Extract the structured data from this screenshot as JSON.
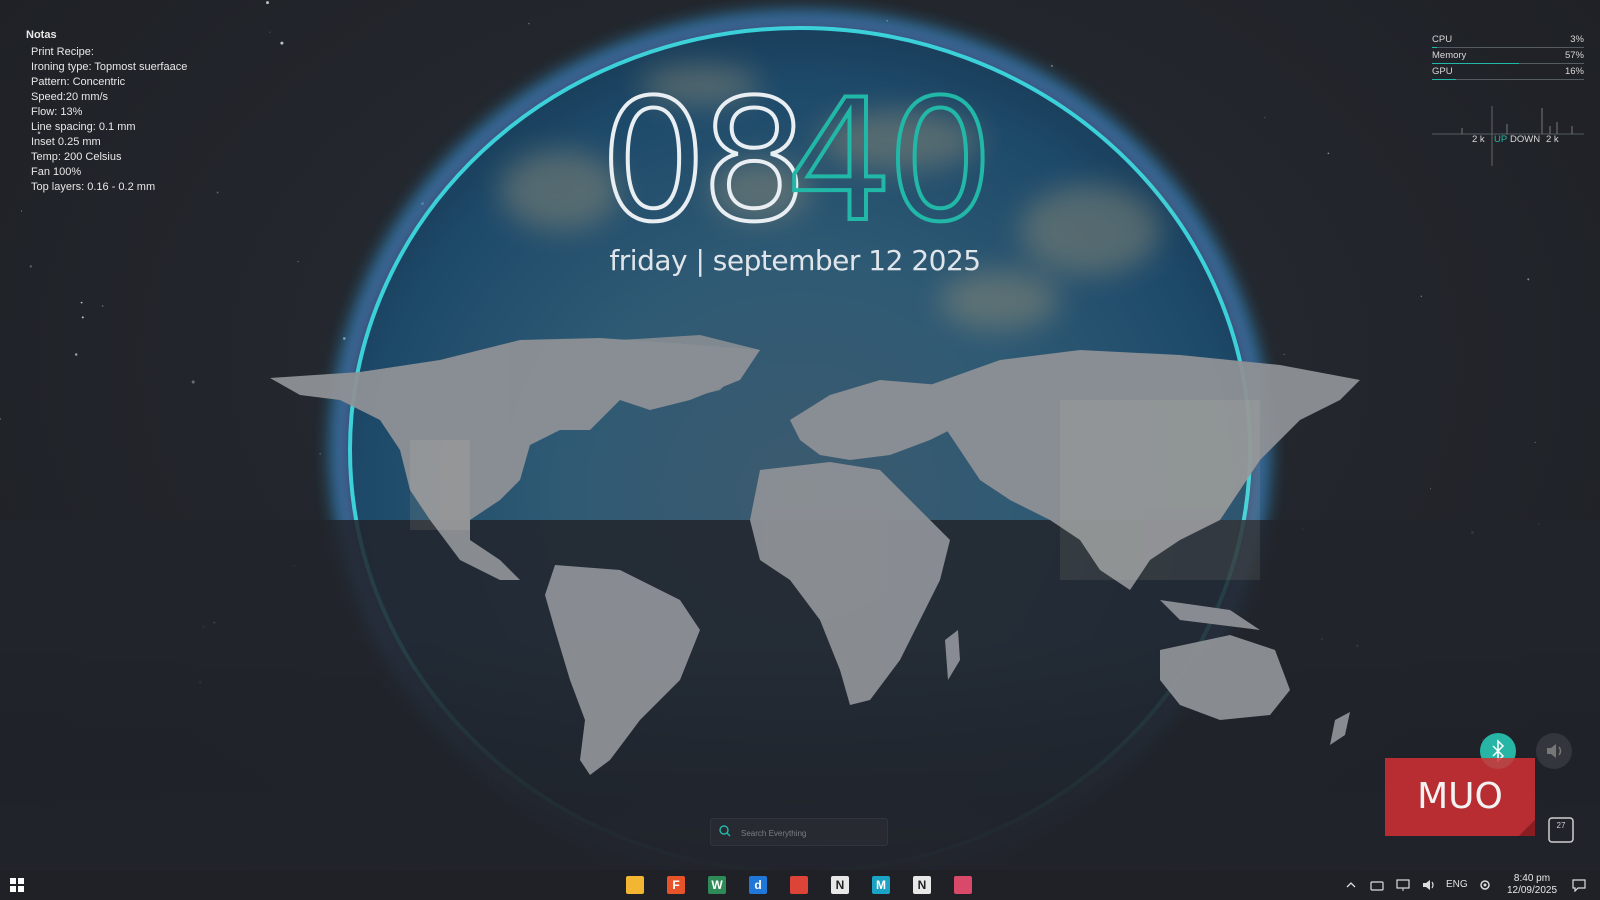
{
  "notes": {
    "title": "Notas",
    "lines": [
      "Print Recipe:",
      "Ironing type: Topmost suerfaace",
      "Pattern: Concentric",
      "Speed:20 mm/s",
      "Flow: 13%",
      "Line spacing: 0.1 mm",
      "Inset 0.25 mm",
      "Temp: 200 Celsius",
      "Fan 100%",
      "Top layers: 0.16 - 0.2 mm"
    ]
  },
  "clock": {
    "hours": "08",
    "minutes": "40"
  },
  "date_line": "friday | september 12 2025",
  "system_monitor": {
    "cpu": {
      "label": "CPU",
      "value": "3%",
      "fraction": 0.03
    },
    "memory": {
      "label": "Memory",
      "value": "57%",
      "fraction": 0.57
    },
    "gpu": {
      "label": "GPU",
      "value": "16%",
      "fraction": 0.16
    },
    "net": {
      "up_value": "2 k",
      "up_label": "UP",
      "down_label": "DOWN",
      "down_value": "2 k"
    }
  },
  "search": {
    "placeholder": "Search Everything"
  },
  "watermark": {
    "text": "MUO"
  },
  "calendar_widget": {
    "day": "27"
  },
  "taskbar": {
    "apps": [
      {
        "name": "file-explorer",
        "glyph": "",
        "color": "#f2b632"
      },
      {
        "name": "app-f",
        "glyph": "F",
        "color": "#e8542a"
      },
      {
        "name": "app-w",
        "glyph": "W",
        "color": "#2e8b57"
      },
      {
        "name": "app-d",
        "glyph": "d",
        "color": "#1f77d8"
      },
      {
        "name": "chrome",
        "glyph": "",
        "color": "#db4437"
      },
      {
        "name": "notion",
        "glyph": "N",
        "color": "#e8e8e8"
      },
      {
        "name": "app-m",
        "glyph": "M",
        "color": "#1aa3c4"
      },
      {
        "name": "notion-2",
        "glyph": "N",
        "color": "#e8e8e8"
      },
      {
        "name": "app-snip",
        "glyph": "",
        "color": "#d94a6a"
      }
    ],
    "language": "ENG",
    "time": "8:40 pm",
    "date": "12/09/2025"
  },
  "colors": {
    "accent": "#22b8a8",
    "bluetooth": "#27b6a6"
  }
}
